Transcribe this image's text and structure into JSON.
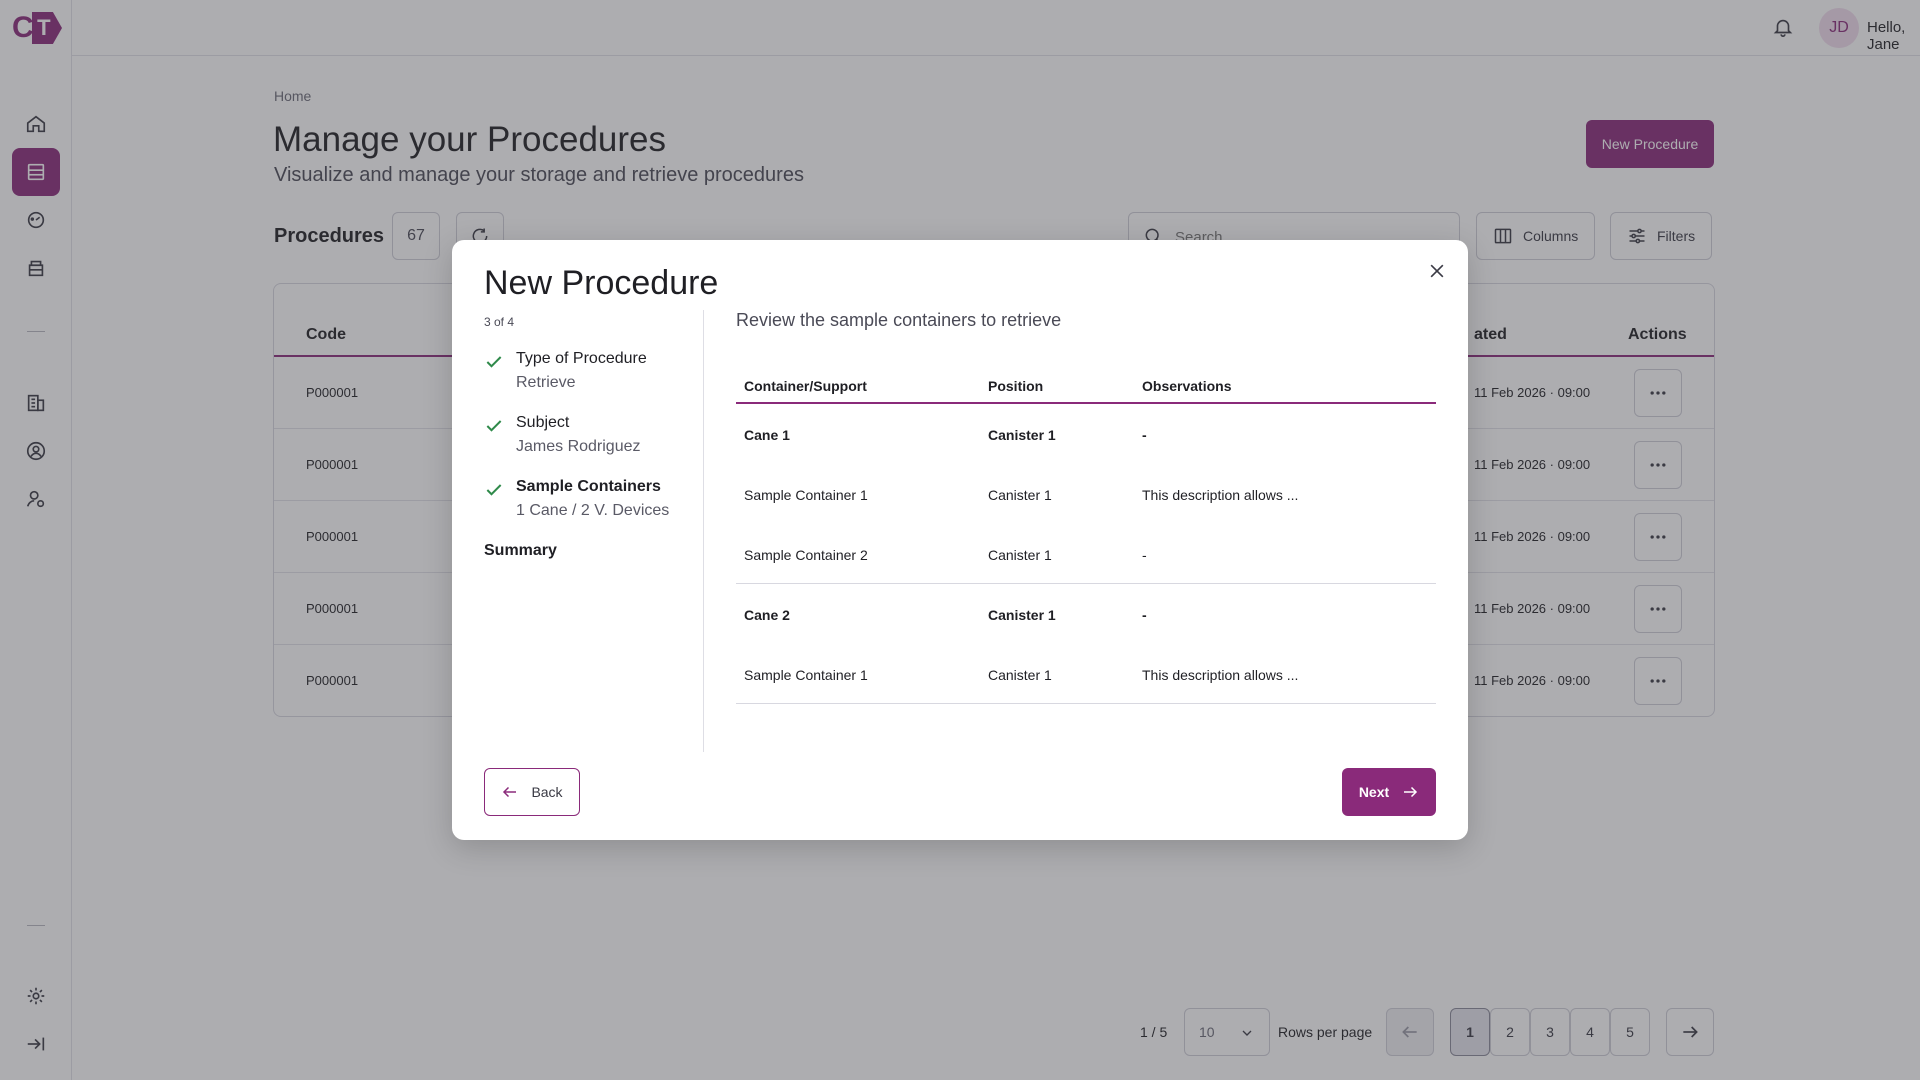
{
  "brand": {
    "logo_c": "C",
    "logo_t": "T",
    "accent": "#8a2a7a"
  },
  "header": {
    "user_initials": "JD",
    "greeting": "Hello, Jane"
  },
  "sidebar": {
    "items": [
      {
        "icon": "home-icon"
      },
      {
        "icon": "procedures-icon",
        "active": true
      },
      {
        "icon": "dashboard-icon"
      },
      {
        "icon": "inventory-icon"
      },
      {
        "icon": "building-icon"
      },
      {
        "icon": "user-circle-icon"
      },
      {
        "icon": "user-settings-icon"
      },
      {
        "icon": "gear-icon"
      },
      {
        "icon": "collapse-icon"
      }
    ]
  },
  "page": {
    "breadcrumb": "Home",
    "title": "Manage your Procedures",
    "subtitle": "Visualize and manage your storage and retrieve procedures",
    "new_button": "New Procedure"
  },
  "procedures": {
    "label": "Procedures",
    "count": "67",
    "search_placeholder": "Search",
    "columns_label": "Columns",
    "filters_label": "Filters",
    "headers": {
      "code": "Code",
      "created": "ated",
      "actions": "Actions"
    },
    "rows": [
      {
        "code": "P000001",
        "date": "11 Feb 2026 · 09:00"
      },
      {
        "code": "P000001",
        "date": "11 Feb 2026 · 09:00"
      },
      {
        "code": "P000001",
        "date": "11 Feb 2026 · 09:00"
      },
      {
        "code": "P000001",
        "date": "11 Feb 2026 · 09:00"
      },
      {
        "code": "P000001",
        "date": "11 Feb 2026 · 09:00"
      }
    ]
  },
  "pagination": {
    "info": "1 / 5",
    "rows_value": "10",
    "rows_label": "Rows per page",
    "pages": [
      "1",
      "2",
      "3",
      "4",
      "5"
    ],
    "current": "1"
  },
  "modal": {
    "title": "New Procedure",
    "step_indicator": "3 of 4",
    "steps": [
      {
        "name": "Type of Procedure",
        "value": "Retrieve",
        "done": true
      },
      {
        "name": "Subject",
        "value": "James Rodriguez",
        "done": true
      },
      {
        "name": "Sample Containers",
        "value": "1 Cane / 2 V. Devices",
        "done": true
      }
    ],
    "summary_label": "Summary",
    "review_title": "Review the sample containers to retrieve",
    "table": {
      "headers": {
        "container": "Container/Support",
        "position": "Position",
        "observations": "Observations"
      },
      "rows": [
        {
          "container": "Cane 1",
          "position": "Canister 1",
          "observations": "-",
          "bold": true
        },
        {
          "container": "Sample Container 1",
          "position": "Canister 1",
          "observations": "This description allows ..."
        },
        {
          "container": "Sample Container 2",
          "position": "Canister 1",
          "observations": "-"
        },
        {
          "container": "Cane 2",
          "position": "Canister 1",
          "observations": "-",
          "bold": true
        },
        {
          "container": "Sample Container 1",
          "position": "Canister 1",
          "observations": "This description allows ..."
        }
      ]
    },
    "back_label": "Back",
    "next_label": "Next"
  }
}
